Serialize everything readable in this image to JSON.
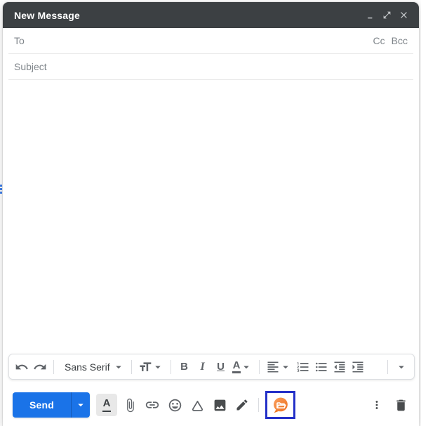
{
  "titlebar": {
    "title": "New Message",
    "control_icons": [
      "minimize-icon",
      "open-in-full-icon",
      "close-icon"
    ]
  },
  "recipients": {
    "to_placeholder": "To",
    "cc_label": "Cc",
    "bcc_label": "Bcc"
  },
  "subject": {
    "placeholder": "Subject"
  },
  "body": {
    "text": ""
  },
  "format_toolbar": {
    "font_family": "Sans Serif",
    "bold_label": "B",
    "italic_label": "I",
    "underline_label": "U",
    "text_color_label": "A",
    "icons": [
      "undo-icon",
      "redo-icon",
      "font-dropdown-caret",
      "text-size-icon",
      "align-left-icon",
      "numbered-list-icon",
      "bulleted-list-icon",
      "indent-less-icon",
      "indent-more-icon",
      "more-formatting-caret"
    ]
  },
  "action_bar": {
    "send_label": "Send",
    "send_options": "send-options-caret",
    "formatting_toggle_label": "A",
    "icons": [
      "formatting-options-icon",
      "attach-file-icon",
      "insert-link-icon",
      "insert-emoji-icon",
      "insert-drive-file-icon",
      "insert-photo-icon",
      "signature-pen-icon",
      "extension-chat-folder-icon",
      "more-options-icon",
      "discard-draft-icon"
    ],
    "extension_highlighted": true
  },
  "colors": {
    "titlebar_bg": "#3c4043",
    "send_blue": "#1a73e8",
    "icon_gray": "#5f6368",
    "placeholder_gray": "#80868b",
    "highlight_border_blue": "#2431c8",
    "extension_orange": "#f0741f",
    "divider_gray": "#e9e9e9"
  }
}
